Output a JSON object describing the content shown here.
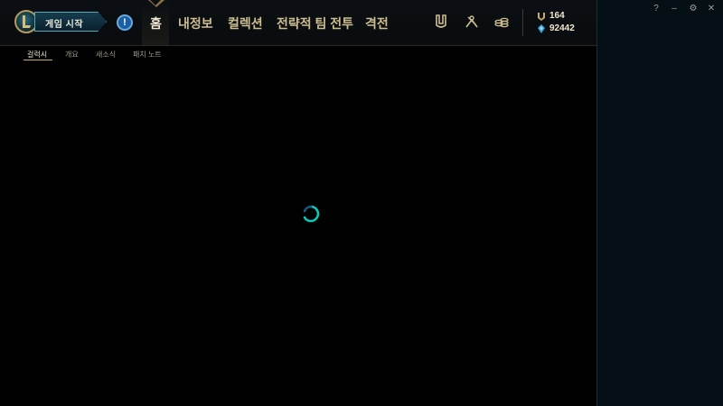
{
  "header": {
    "play_button_label": "게임 시작",
    "alert_label": "!",
    "nav": [
      "홈",
      "내정보",
      "컬렉션",
      "전략적 팀 전투",
      "격전"
    ],
    "active_nav": "홈",
    "tools": [
      {
        "icon": "clash-shield-icon"
      },
      {
        "icon": "loot-icon"
      },
      {
        "icon": "store-coins-icon"
      }
    ]
  },
  "currency": {
    "rp_value": "164",
    "be_value": "92442"
  },
  "window_controls": {
    "help": "?",
    "minimize": "–",
    "settings": "⚙",
    "close": "✕"
  },
  "subnav": {
    "tabs": [
      "걸럭시",
      "개요",
      "새소식",
      "패치 노트"
    ],
    "active": 0
  },
  "colors": {
    "gold": "#c8aa6e",
    "teal": "#0ac8b9",
    "background": "#010101"
  }
}
